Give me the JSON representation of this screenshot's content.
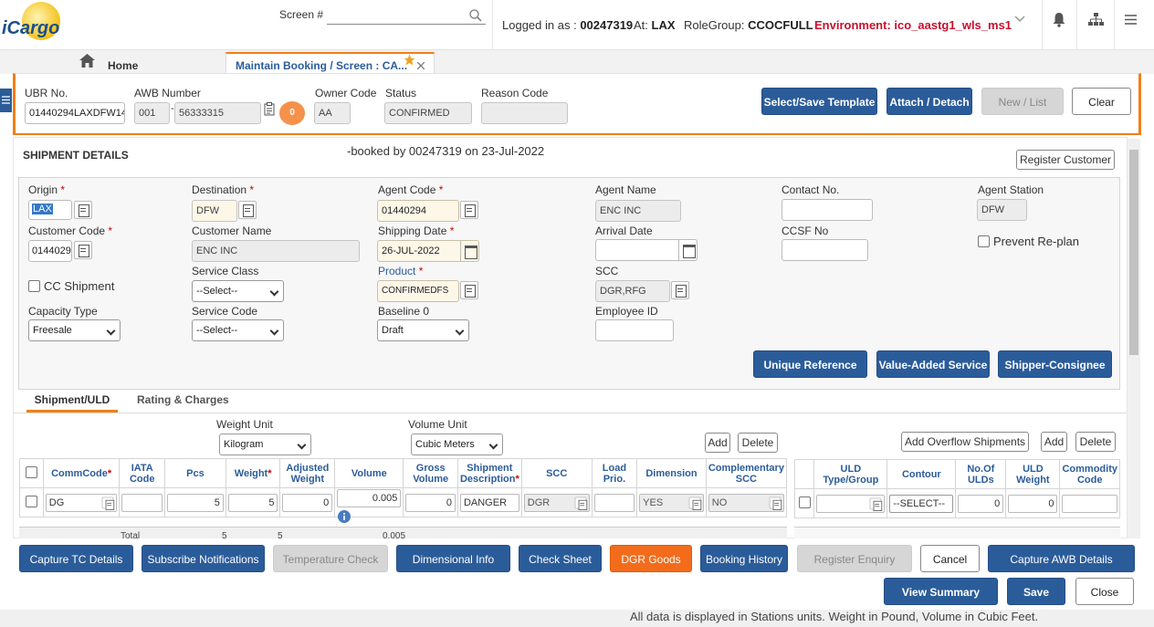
{
  "app": {
    "logo_text": "iCargo"
  },
  "header": {
    "screen_label": "Screen #",
    "screen_value": "",
    "logged_in_label": "Logged in as :",
    "user": "00247319",
    "at_label": "At:",
    "station": "LAX",
    "rolegroup_label": "RoleGroup:",
    "rolegroup": "CCOCFULL",
    "environment": "Environment: ico_aastg1_wls_ms1"
  },
  "tabs": {
    "home": "Home",
    "active": "Maintain Booking / Screen : CA..."
  },
  "topform": {
    "ubr_label": "UBR No.",
    "ubr_value": "01440294LAXDFW14",
    "awb_label": "AWB Number",
    "awb_prefix": "001",
    "awb_number": "56333315",
    "badge_count": "0",
    "owner_label": "Owner Code",
    "owner_value": "AA",
    "status_label": "Status",
    "status_value": "CONFIRMED",
    "reason_label": "Reason Code",
    "reason_value": "",
    "btn_template": "Select/Save Template",
    "btn_attach": "Attach / Detach",
    "btn_newlist": "New / List",
    "btn_clear": "Clear"
  },
  "shipment": {
    "title": "SHIPMENT DETAILS",
    "booked_by": "-booked by 00247319 on 23-Jul-2022",
    "register_customer": "Register Customer",
    "origin_label": "Origin",
    "origin": "LAX",
    "destination_label": "Destination",
    "destination": "DFW",
    "agent_code_label": "Agent Code",
    "agent_code": "01440294",
    "agent_name_label": "Agent Name",
    "agent_name": "ENC INC",
    "contact_label": "Contact No.",
    "contact": "",
    "agent_station_label": "Agent Station",
    "agent_station": "DFW",
    "customer_code_label": "Customer Code",
    "customer_code": "0144029",
    "customer_name_label": "Customer Name",
    "customer_name": "ENC INC",
    "shipping_date_label": "Shipping Date",
    "shipping_date": "26-JUL-2022",
    "arrival_label": "Arrival Date",
    "arrival": "",
    "ccsf_label": "CCSF No",
    "ccsf": "",
    "prevent_label": "Prevent Re-plan",
    "cc_shipment_label": "CC Shipment",
    "service_class_label": "Service Class",
    "service_class": "--Select--",
    "product_label": "Product",
    "product": "CONFIRMEDFS",
    "scc_label": "SCC",
    "scc": "DGR,RFG",
    "capacity_label": "Capacity Type",
    "capacity": "Freesale",
    "service_code_label": "Service Code",
    "service_code": "--Select--",
    "baseline_label": "Baseline 0",
    "baseline": "Draft",
    "employee_label": "Employee ID",
    "employee": "",
    "btn_unique": "Unique Reference",
    "btn_vas": "Value-Added Service",
    "btn_shipper": "Shipper-Consignee"
  },
  "subtabs": {
    "shipment_uld": "Shipment/ULD",
    "rating": "Rating & Charges"
  },
  "grid": {
    "weight_unit_label": "Weight Unit",
    "weight_unit": "Kilogram",
    "volume_unit_label": "Volume Unit",
    "volume_unit": "Cubic Meters",
    "add": "Add",
    "delete": "Delete",
    "headers": [
      "CommCode",
      "IATA Code",
      "Pcs",
      "Weight",
      "Adjusted Weight",
      "Volume",
      "Gross Volume",
      "Shipment Description",
      "SCC",
      "Load Prio.",
      "Dimension",
      "Complementary SCC"
    ],
    "row": {
      "commcode": "DG",
      "iata": "",
      "pcs": "5",
      "weight": "5",
      "adj_weight": "0",
      "volume": "0.005",
      "gross_volume": "0",
      "description": "DANGER",
      "scc": "DGR",
      "load_prio": "",
      "dimension": "YES",
      "comp_scc": "NO"
    },
    "totals": {
      "label": "Total",
      "pcs": "5",
      "weight": "5",
      "volume": "0.005"
    }
  },
  "uld": {
    "add_overflow": "Add Overflow Shipments",
    "add": "Add",
    "delete": "Delete",
    "headers": [
      "ULD Type/Group",
      "Contour",
      "No.Of ULDs",
      "ULD Weight",
      "Commodity Code"
    ],
    "row": {
      "type": "",
      "contour": "--SELECT--",
      "num": "0",
      "weight": "0",
      "commodity": ""
    }
  },
  "actions": {
    "capture_tc": "Capture TC Details",
    "subscribe": "Subscribe Notifications",
    "temperature": "Temperature Check",
    "dimensional": "Dimensional Info",
    "check_sheet": "Check Sheet",
    "dgr": "DGR Goods",
    "booking_history": "Booking History",
    "register_enquiry": "Register Enquiry",
    "cancel": "Cancel",
    "capture_awb": "Capture AWB Details",
    "view_summary": "View Summary",
    "save": "Save",
    "close": "Close"
  },
  "footer": {
    "note": "All data is displayed in Stations units. Weight in Pound, Volume in Cubic Feet."
  },
  "colors": {
    "primary": "#2b5c9a",
    "accent": "#f07f1a",
    "env_red": "#c8102e",
    "dgr_orange": "#f26c1b"
  },
  "icons": [
    "search-icon",
    "home-icon",
    "star-icon",
    "close-icon",
    "bell-icon",
    "sitemap-icon",
    "hamburger-icon",
    "calendar-icon",
    "lookup-icon",
    "info-icon",
    "chevron-down-icon"
  ]
}
